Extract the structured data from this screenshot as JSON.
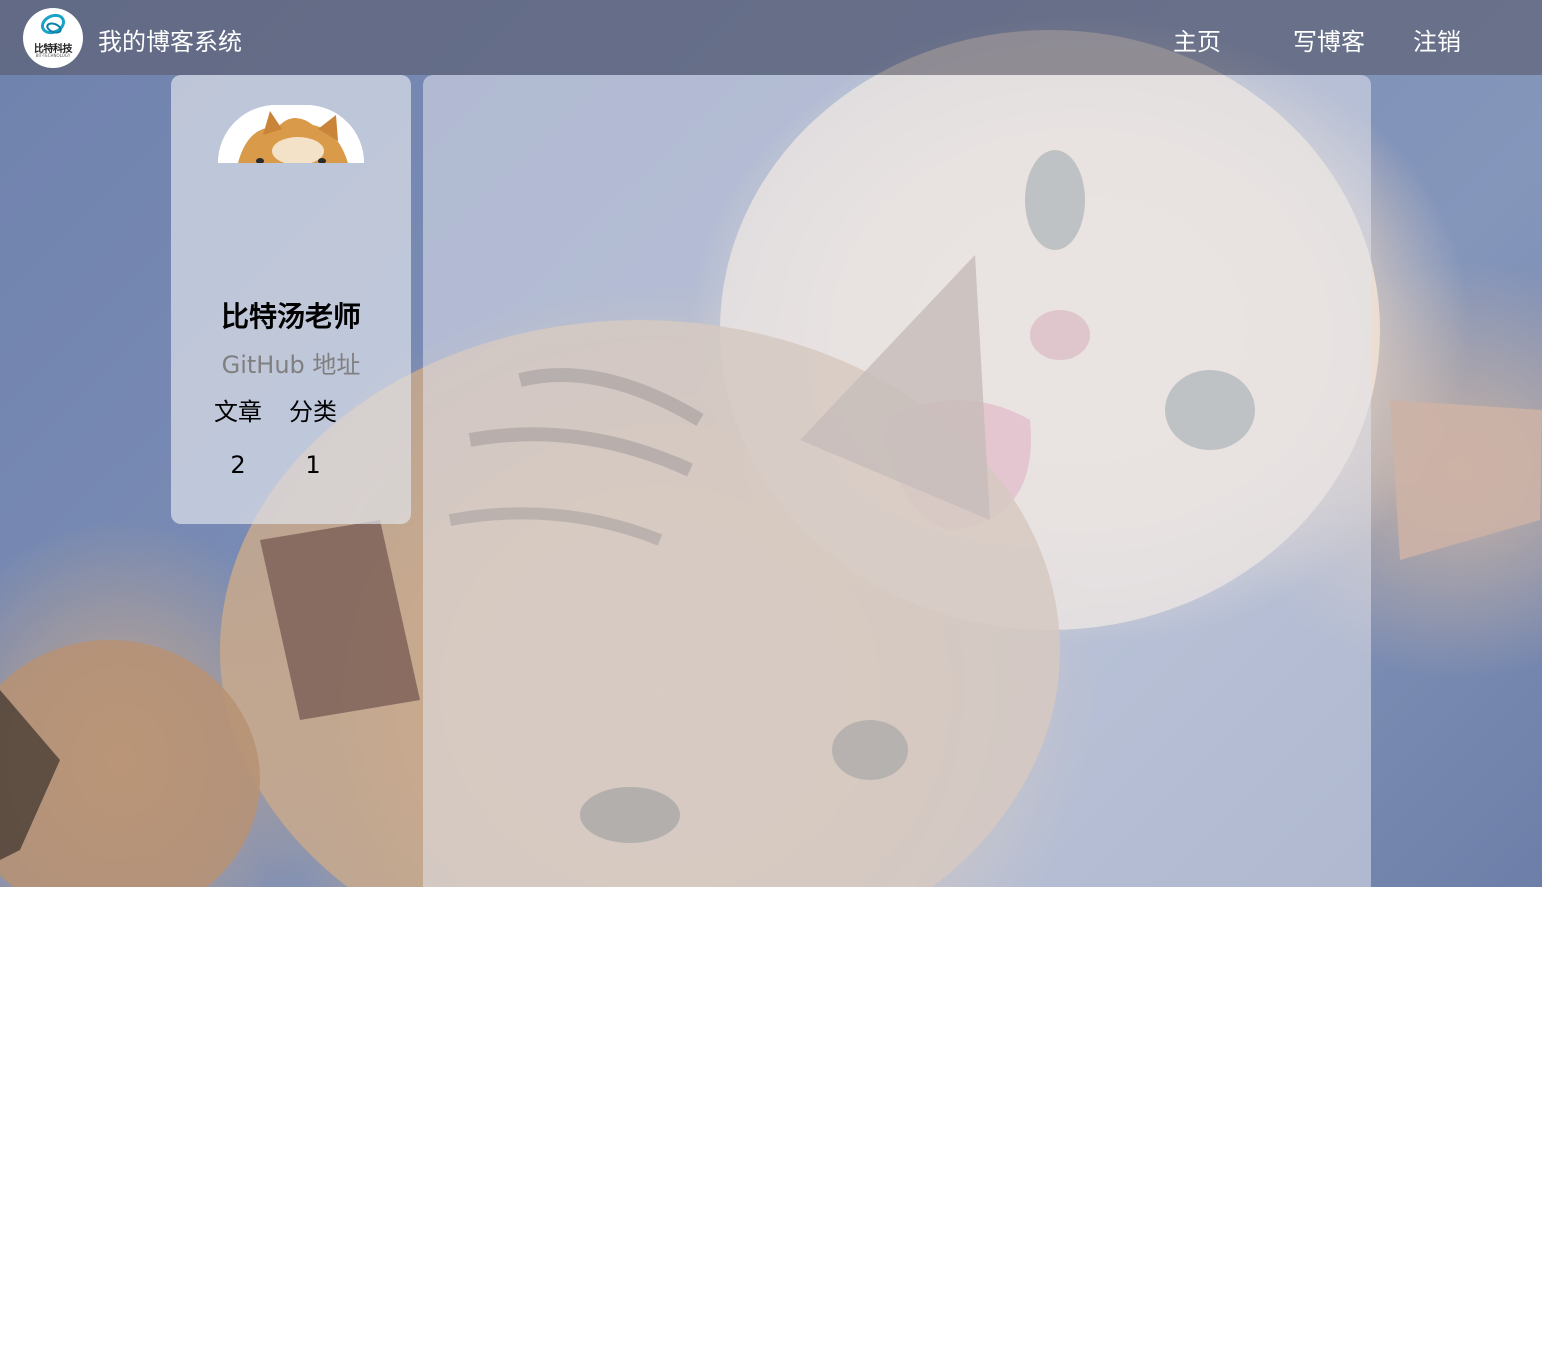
{
  "header": {
    "logo": {
      "icon": "bit-technology-logo-icon",
      "text": "比特科技",
      "subtext": "BIT-TECHNOLOGY"
    },
    "site_title": "我的博客系统",
    "nav": {
      "home": "主页",
      "write": "写博客",
      "logout": "注销"
    }
  },
  "background": {
    "icon": "kittens-photo"
  },
  "profile": {
    "avatar_icon": "shiba-avatar-icon",
    "username": "比特汤老师",
    "github_link": "GitHub 地址",
    "stats": {
      "articles_label": "文章",
      "categories_label": "分类",
      "articles_count": "2",
      "categories_count": "1"
    }
  },
  "content": {
    "posts": []
  }
}
